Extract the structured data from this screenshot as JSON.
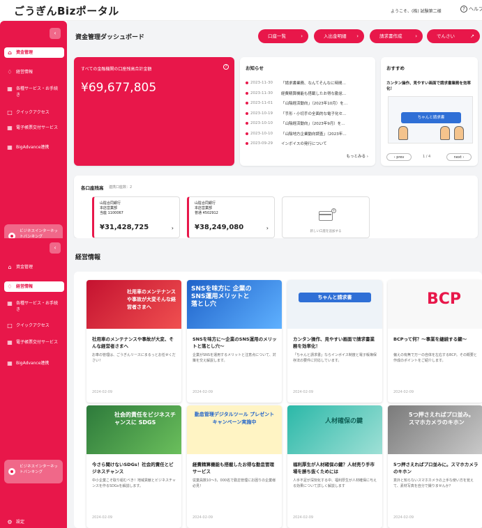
{
  "header": {
    "logo": "ごうぎんBizポータル",
    "welcome": "ようこそ、(株) 試験第二様",
    "help": "ヘルプ"
  },
  "sidebar": {
    "items": [
      {
        "label": "資金管理",
        "icon": "yen-icon"
      },
      {
        "label": "経営情報",
        "icon": "bulb-icon"
      },
      {
        "label": "各種サービス・お手続き",
        "icon": "grid-icon"
      },
      {
        "label": "クイックアクセス",
        "icon": "bookmark-icon"
      },
      {
        "label": "電子帳票交付サービス",
        "icon": "grid-icon"
      },
      {
        "label": "BigAdvance連携",
        "icon": "grid-icon"
      }
    ],
    "bottom_button": "ビジネスインターネットバンキング",
    "settings": "設定"
  },
  "dashboard": {
    "title": "資金管理ダッシュボード",
    "buttons": [
      {
        "label": "口座一覧"
      },
      {
        "label": "入出金明細"
      },
      {
        "label": "請求書作成"
      },
      {
        "label": "でんさい"
      }
    ],
    "balance": {
      "label": "すべての金融機関の口座残高合計金額",
      "amount": "¥69,677,805"
    },
    "news": {
      "heading": "お知らせ",
      "items": [
        {
          "date": "2023-11-30",
          "title": "「請求書業務、なんてそんなに時間…"
        },
        {
          "date": "2023-11-30",
          "title": "経費精算機能も搭載したお得な勤怠…"
        },
        {
          "date": "2023-11-01",
          "title": "「山陰経済動向」（2023年10月）を…"
        },
        {
          "date": "2023-10-19",
          "title": "「手形・小切手の全面的な電子化セ…"
        },
        {
          "date": "2023-10-10",
          "title": "「山陰経済動向」（2023年9月）を…"
        },
        {
          "date": "2023-10-10",
          "title": "「山陰地方企業動向調査」（2023年…"
        },
        {
          "date": "2023-09-29",
          "title": "インボイスの発行について"
        }
      ],
      "more": "もっとみる ›"
    },
    "recommend": {
      "heading": "おすすめ",
      "title": "カンタン操作、見やすい画面で請求書業務を効率化！",
      "banner_text": "ちゃんと請求書",
      "prev": "‹ prev",
      "page": "1 / 4",
      "next": "next ›"
    },
    "accounts": {
      "heading": "各口座残高",
      "count": "連携口座数：2",
      "items": [
        {
          "bank": "山陰合同銀行",
          "branch": "本店営業部",
          "number": "当座 1100067",
          "amount": "¥31,428,725"
        },
        {
          "bank": "山陰合同銀行",
          "branch": "本店営業部",
          "number": "普通 4502912",
          "amount": "¥38,249,080"
        }
      ],
      "add_label": "新しい口座を追加する"
    }
  },
  "management": {
    "title": "経営情報",
    "articles": [
      {
        "thumb": "社用車のメンテナンスや事故が大変そんな経営者さまへ",
        "title": "社用車のメンテナンスや事故が大変、そんな経営者さまへ",
        "desc": "お車の管理は、ごうぎんリースにまるっとお任せください！",
        "date": "2024-02-09"
      },
      {
        "thumb": "SNSを味方に 企業のSNS運用メリットと落とし穴",
        "title": "SNSを味方に～企業のSNS運用のメリットと落とし穴～",
        "desc": "企業がSNSを運用するメリットと注意点について、対策を交え解説します。",
        "date": "2024-02-09"
      },
      {
        "thumb": "ちゃんと請求書",
        "title": "カンタン操作、見やすい画面で請求書業務を効率化！",
        "desc": "「ちゃんと請求書」ならインボイス制度と電子帳簿保存法の要件に対応しています。",
        "date": "2024-02-09"
      },
      {
        "thumb": "BCP",
        "title": "BCPって何？～事業を継続する鍵～",
        "desc": "偏えの有無で万一の自体を左右するBCP。その概要と作成のポイントをご紹介します。",
        "date": "2024-02-09"
      },
      {
        "thumb": "社会的責任をビジネスチャンスに SDGS",
        "title": "今さら聞けないSDGs！社会的責任とビジネスチャンス",
        "desc": "中小企業こそ取り組むべき！地域貢献とビジネスチャンスを作るSDGsを解説します。",
        "date": "2024-02-09"
      },
      {
        "thumb": "勤怠管理デジタルツール プレゼントキャンペーン実施中",
        "title": "経費精算機能も搭載したお得な勤怠管理サービス",
        "desc": "従業員数10～3，000名で勤怠管理にお困りの企業様必見！",
        "date": "2024-02-09"
      },
      {
        "thumb": "人材確保の鍵",
        "title": "福利厚生が人材確保の鍵？人材売り手市場を勝ち抜くためには",
        "desc": "人手不足が深刻化する中、福利厚生が人材確保に与える効果について詳しく解説します",
        "date": "2024-02-09"
      },
      {
        "thumb": "5つ押さえればプロ並み。スマホカメラのキホン",
        "title": "5つ押さえればプロ並みに。スマホカメラのキホン",
        "desc": "意外と知らないスマホカメラの上手な使い方を覚えて、素材写真を自分で撮りませんか？",
        "date": "2024-02-09"
      }
    ]
  },
  "colors": {
    "accent": "#e8174a",
    "background": "#f3f4f6"
  }
}
